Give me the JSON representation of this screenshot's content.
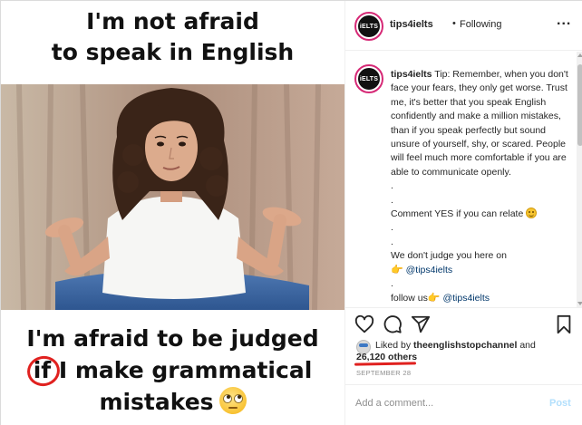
{
  "meme": {
    "top_line1": "I'm not afraid",
    "top_line2": "to speak in English",
    "bottom_line1": "I'm afraid to be judged",
    "bottom_if": "if",
    "bottom_line2_rest": " I make grammatical",
    "bottom_line3": "mistakes"
  },
  "header": {
    "avatar_text": "iELTS",
    "username": "tips4ielts",
    "separator": "•",
    "follow_status": "Following",
    "more": "..."
  },
  "caption": {
    "avatar_text": "iELTS",
    "username": "tips4ielts",
    "text": "Tip: Remember, when you don't face your fears, they only get worse. Trust me, it's better that you speak English confidently and make a million mistakes, than if you speak perfectly but sound unsure of yourself, shy, or scared. People will feel much more comfortable if you are able to communicate openly.",
    "dot1": ".",
    "dot2": ".",
    "comment_yes": "Comment YES if you can relate",
    "dot3": ".",
    "dot4": ".",
    "judge_line": "We don't judge you here on",
    "hand": "👉",
    "mention1": "@tips4ielts",
    "dot5": ".",
    "follow_us": "follow us",
    "mention2": "@tips4ielts"
  },
  "actions": {
    "icons": [
      "heart-icon",
      "comment-icon",
      "share-icon",
      "bookmark-icon"
    ]
  },
  "likes": {
    "prefix": "Liked by",
    "liker": "theenglishstopchannel",
    "and": "and",
    "count": "26,120 others"
  },
  "post_date": "SEPTEMBER 28",
  "comment_box": {
    "placeholder": "Add a comment...",
    "post_label": "Post"
  },
  "colors": {
    "annotation_red": "#e0211f",
    "post_disabled": "#b2dffc",
    "avatar_ring": "#d62976"
  }
}
